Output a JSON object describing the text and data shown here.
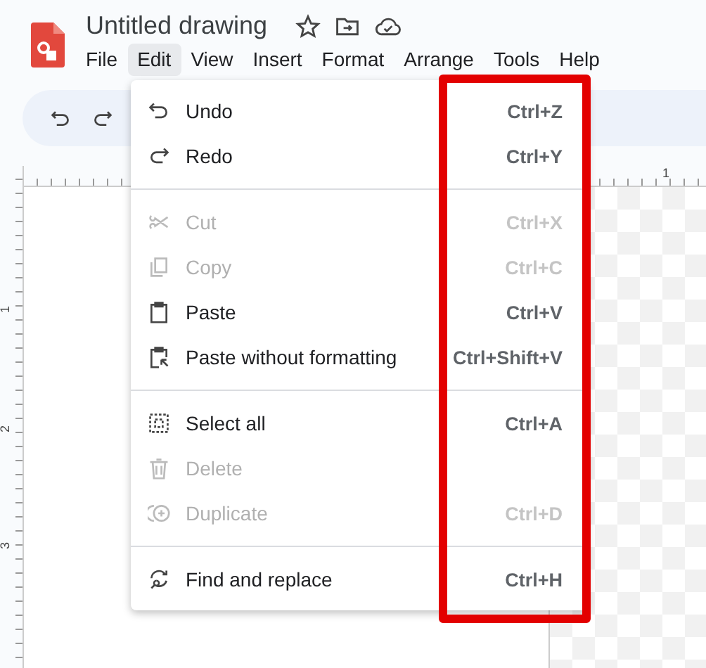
{
  "document": {
    "title": "Untitled drawing"
  },
  "menu_bar": [
    {
      "label": "File",
      "selected": false
    },
    {
      "label": "Edit",
      "selected": true
    },
    {
      "label": "View",
      "selected": false
    },
    {
      "label": "Insert",
      "selected": false
    },
    {
      "label": "Format",
      "selected": false
    },
    {
      "label": "Arrange",
      "selected": false
    },
    {
      "label": "Tools",
      "selected": false
    },
    {
      "label": "Help",
      "selected": false
    }
  ],
  "top_ruler": {
    "labels": [
      "1"
    ]
  },
  "left_ruler": {
    "labels": [
      "1",
      "2",
      "3"
    ]
  },
  "edit_menu": [
    {
      "kind": "item",
      "label": "Undo",
      "shortcut": "Ctrl+Z",
      "disabled": false
    },
    {
      "kind": "item",
      "label": "Redo",
      "shortcut": "Ctrl+Y",
      "disabled": false
    },
    {
      "kind": "divider"
    },
    {
      "kind": "item",
      "label": "Cut",
      "shortcut": "Ctrl+X",
      "disabled": true
    },
    {
      "kind": "item",
      "label": "Copy",
      "shortcut": "Ctrl+C",
      "disabled": true
    },
    {
      "kind": "item",
      "label": "Paste",
      "shortcut": "Ctrl+V",
      "disabled": false
    },
    {
      "kind": "item",
      "label": "Paste without formatting",
      "shortcut": "Ctrl+Shift+V",
      "disabled": false
    },
    {
      "kind": "divider"
    },
    {
      "kind": "item",
      "label": "Select all",
      "shortcut": "Ctrl+A",
      "disabled": false
    },
    {
      "kind": "item",
      "label": "Delete",
      "disabled": true
    },
    {
      "kind": "item",
      "label": "Duplicate",
      "shortcut": "Ctrl+D",
      "disabled": true
    },
    {
      "kind": "divider"
    },
    {
      "kind": "item",
      "label": "Find and replace",
      "shortcut": "Ctrl+H",
      "disabled": false
    }
  ]
}
